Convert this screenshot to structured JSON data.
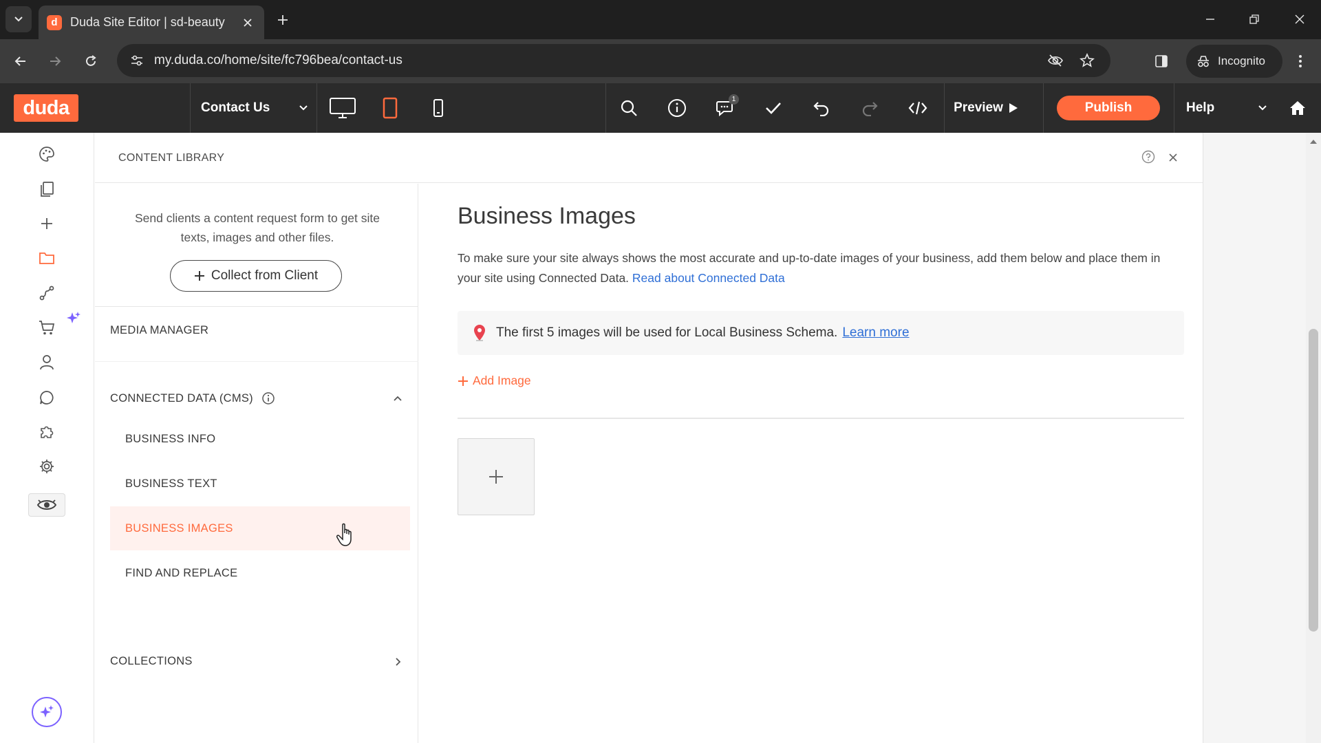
{
  "browser": {
    "tab_title": "Duda Site Editor | sd-beauty",
    "favicon_letter": "d",
    "url": "my.duda.co/home/site/fc796bea/contact-us",
    "profile_label": "Incognito"
  },
  "editor": {
    "logo_text": "duda",
    "current_page": "Contact Us",
    "active_device": "tablet",
    "preview_label": "Preview",
    "publish_label": "Publish",
    "help_label": "Help",
    "comments_badge": "1",
    "accent_color": "#ff6a3d"
  },
  "panel": {
    "title": "CONTENT LIBRARY",
    "collect_description": "Send clients a content request form to get site texts, images and other files.",
    "collect_button": "Collect from Client",
    "media_manager": "MEDIA MANAGER",
    "connected_data": "CONNECTED DATA (CMS)",
    "sub_items": [
      "BUSINESS INFO",
      "BUSINESS TEXT",
      "BUSINESS IMAGES",
      "FIND AND REPLACE"
    ],
    "selected_item": "BUSINESS IMAGES",
    "collections": "COLLECTIONS"
  },
  "content": {
    "heading": "Business Images",
    "description": "To make sure your site always shows the most accurate and up-to-date images of your business, add them below and place them in your site using Connected Data.",
    "description_link": "Read about Connected Data",
    "notice_text": "The first 5 images will be used for Local Business Schema.",
    "notice_link": "Learn more",
    "add_image_label": "Add Image"
  },
  "icons": {
    "rail": [
      "palette-icon",
      "pages-icon",
      "plus-icon",
      "folder-icon",
      "flow-icon",
      "cart-icon",
      "user-icon",
      "chat-icon",
      "puzzle-icon",
      "gear-icon",
      "eye-icon",
      "ai-sparkle-icon"
    ],
    "toolbar": [
      "search-icon",
      "info-icon",
      "comments-icon",
      "check-icon",
      "undo-icon",
      "redo-icon",
      "code-icon",
      "home-icon"
    ]
  }
}
